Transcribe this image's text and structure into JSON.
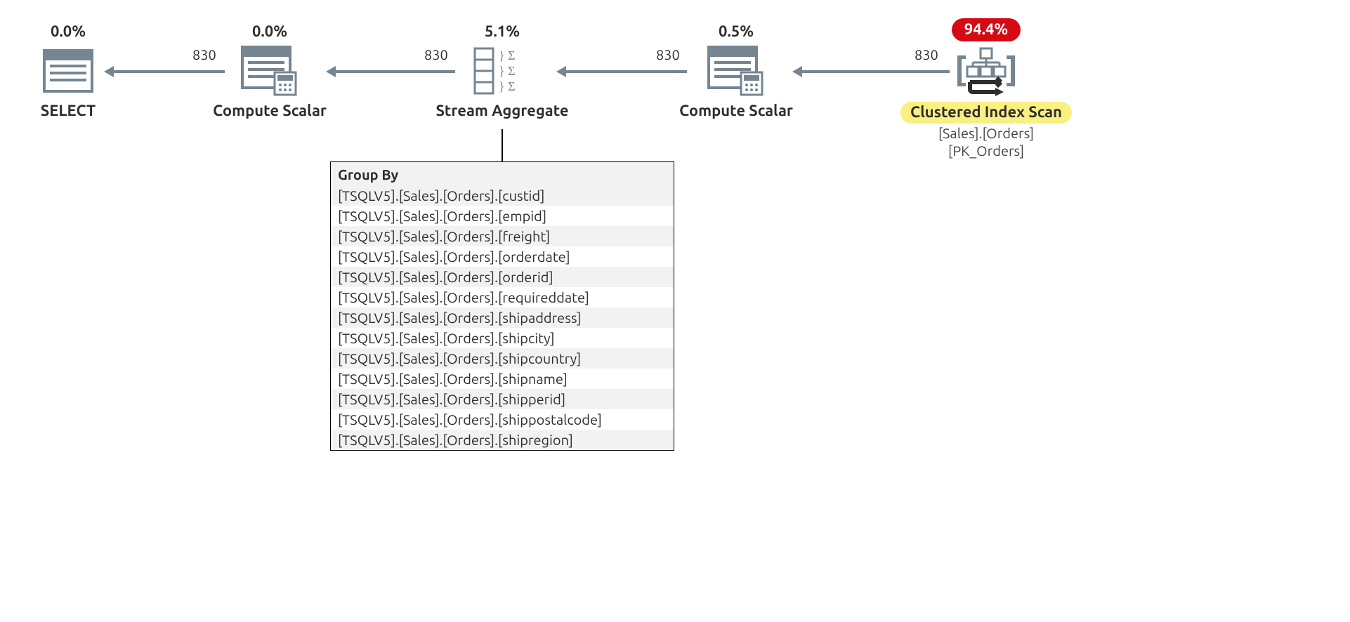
{
  "nodes": {
    "select": {
      "cost": "0.0%",
      "label": "SELECT"
    },
    "compute1": {
      "cost": "0.0%",
      "label": "Compute Scalar"
    },
    "stream_agg": {
      "cost": "5.1%",
      "label": "Stream Aggregate"
    },
    "compute2": {
      "cost": "0.5%",
      "label": "Compute Scalar"
    },
    "index_scan": {
      "cost": "94.4%",
      "label": "Clustered Index Scan",
      "sub1": "[Sales].[Orders]",
      "sub2": "[PK_Orders]"
    }
  },
  "arrows": {
    "a1": {
      "rows": "830"
    },
    "a2": {
      "rows": "830"
    },
    "a3": {
      "rows": "830"
    },
    "a4": {
      "rows": "830"
    }
  },
  "detail": {
    "title": "Group By",
    "rows": [
      "[TSQLV5].[Sales].[Orders].[custid]",
      "[TSQLV5].[Sales].[Orders].[empid]",
      "[TSQLV5].[Sales].[Orders].[freight]",
      "[TSQLV5].[Sales].[Orders].[orderdate]",
      "[TSQLV5].[Sales].[Orders].[orderid]",
      "[TSQLV5].[Sales].[Orders].[requireddate]",
      "[TSQLV5].[Sales].[Orders].[shipaddress]",
      "[TSQLV5].[Sales].[Orders].[shipcity]",
      "[TSQLV5].[Sales].[Orders].[shipcountry]",
      "[TSQLV5].[Sales].[Orders].[shipname]",
      "[TSQLV5].[Sales].[Orders].[shipperid]",
      "[TSQLV5].[Sales].[Orders].[shippostalcode]",
      "[TSQLV5].[Sales].[Orders].[shipregion]"
    ]
  }
}
